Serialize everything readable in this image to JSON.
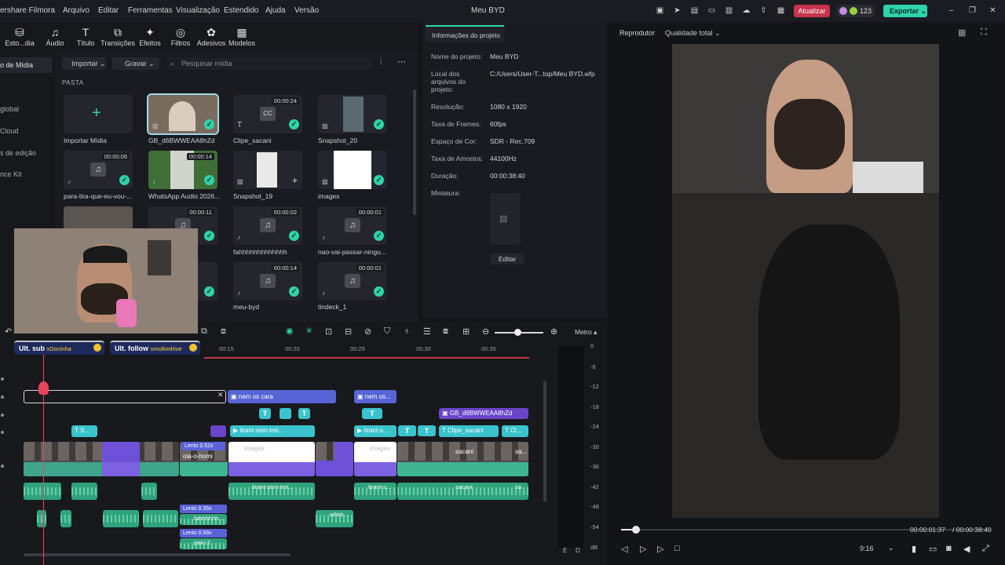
{
  "app": {
    "brand": "ershare Filmora",
    "title": "Meu BYD",
    "menu": [
      "Arquivo",
      "Editar",
      "Ferramentas",
      "Visualização",
      "Estendido",
      "Ajuda",
      "Versão"
    ],
    "upgrade_label": "Atualizar",
    "credits": "123",
    "export_label": "Exportar"
  },
  "toolbar": {
    "tools": [
      "Esto...dia",
      "Áudio",
      "Título",
      "Transições",
      "Efeitos",
      "Filtros",
      "Adesivos",
      "Modelos"
    ]
  },
  "leftnav": {
    "items": [
      "o de Mídia",
      "global",
      "Cloud",
      "s de edição",
      "nce Kit"
    ]
  },
  "media": {
    "import_label": "Importar",
    "record_label": "Gravar",
    "search_placeholder": "Pesquisar mídia",
    "folder_label": "PASTA",
    "items": [
      {
        "caption": "Importar Mídia",
        "duration": ""
      },
      {
        "caption": "GB_d6BWWEAA8hZd",
        "duration": ""
      },
      {
        "caption": "Clipe_sacani",
        "duration": "00:00:24"
      },
      {
        "caption": "Snapshot_20",
        "duration": ""
      },
      {
        "caption": "para-tira-que-eu-vou-...",
        "duration": "00:00:06"
      },
      {
        "caption": "WhatsApp Audio 2026...",
        "duration": "00:00:14"
      },
      {
        "caption": "Snapshot_19",
        "duration": ""
      },
      {
        "caption": "images",
        "duration": ""
      },
      {
        "caption": "",
        "duration": ""
      },
      {
        "caption": "",
        "duration": "00:00:11"
      },
      {
        "caption": "fahhhhhhhhhhhhh",
        "duration": "00:00:02"
      },
      {
        "caption": "nao-vai-passar-ningu...",
        "duration": "00:00:01"
      },
      {
        "caption": "meu-byd",
        "duration": "00:00:14"
      },
      {
        "caption": "tindeck_1",
        "duration": "00:00:01"
      }
    ]
  },
  "info": {
    "tab": "Informações do projeto",
    "rows": [
      {
        "label": "Nome do projeto:",
        "value": "Meu BYD"
      },
      {
        "label": "Local dos arquivos do projeto:",
        "value": "C:/Users/User-T...top/Meu BYD.wfp"
      },
      {
        "label": "Resolução:",
        "value": "1080 x 1920"
      },
      {
        "label": "Taxa de Frames:",
        "value": "60fps"
      },
      {
        "label": "Espaço de Cor:",
        "value": "SDR - Rec.709"
      },
      {
        "label": "Taxa de Amostra:",
        "value": "44100Hz"
      },
      {
        "label": "Duração:",
        "value": "00:00:38:40"
      },
      {
        "label": "Miniatura:",
        "value": ""
      }
    ],
    "edit_label": "Editar"
  },
  "player": {
    "label": "Reprodutor",
    "quality": "Qualidade total",
    "current_time": "00:00:01:37",
    "total_time": "/  00:00:38:40",
    "aspect": "9:16",
    "progress_fraction": 0.04
  },
  "timeline": {
    "meter_label": "Metro",
    "ticks": [
      "00:15",
      "00:20",
      "00:25",
      "00:30",
      "00:35"
    ],
    "meter_scale": [
      "0",
      "-6",
      "-12",
      "-18",
      "-24",
      "-30",
      "-36",
      "-42",
      "-48",
      "-54",
      "dB"
    ],
    "meter_lr": [
      "E",
      "D"
    ],
    "title_clips": [
      "nem os cara",
      "nem os..."
    ],
    "overlay_clip": "GB_d6BWWEAA8hZd",
    "text_clips": [
      "S...",
      "tirant-sem-trei...",
      "tirant-s...",
      "Clipe_sacani",
      "Cl..."
    ],
    "video_clips": [
      "Lento 0.52x",
      "oia-o-homi",
      "images",
      "images",
      "sacani",
      "sa..."
    ],
    "audio_clips": [
      "tirant-sem-trei...",
      "tirant-s...",
      "sacani",
      "sa",
      "whist..."
    ],
    "slow_clips": [
      "Lento 0.35x",
      "fahhhhhh...",
      "Lento 0.58x",
      "pain-2"
    ]
  },
  "overlay": {
    "sub1": "Ult. sub",
    "sub1_name": "xDocinha",
    "sub2": "Ult. follow",
    "sub2_name": "smolkedrive"
  },
  "colors": {
    "accent": "#2fd3a8",
    "upgrade": "#c7344b",
    "playhead": "#e8455a"
  }
}
